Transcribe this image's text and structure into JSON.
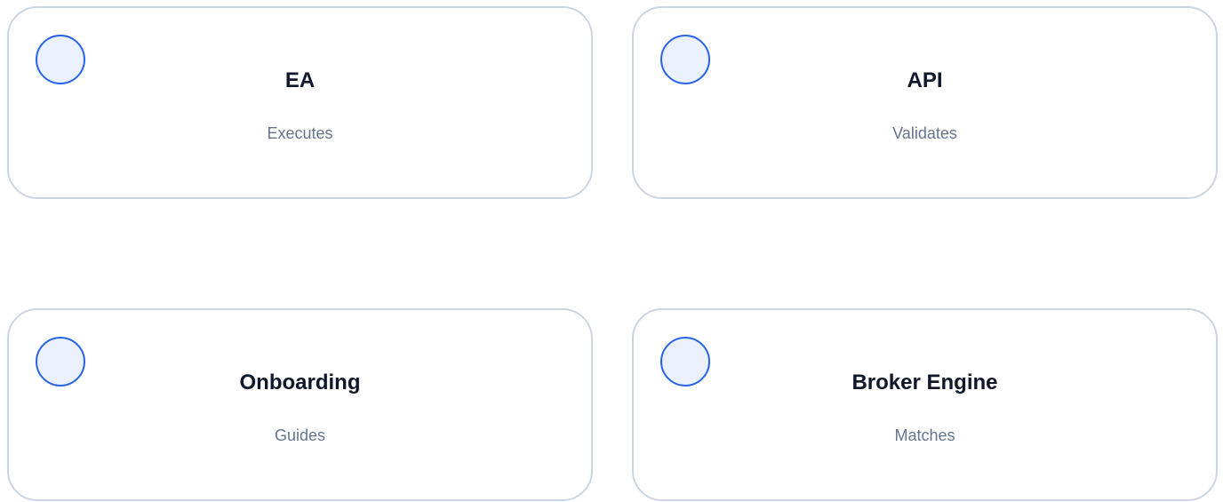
{
  "colors": {
    "card_border": "#cbd5e1",
    "circle_border": "#2563eb",
    "circle_fill": "#eaf0fc",
    "title_text": "#0f172a",
    "subtitle_text": "#64748b"
  },
  "nodes": [
    {
      "icon": "circle-icon",
      "title": "EA",
      "subtitle": "Executes"
    },
    {
      "icon": "circle-icon",
      "title": "API",
      "subtitle": "Validates"
    },
    {
      "icon": "circle-icon",
      "title": "Onboarding",
      "subtitle": "Guides"
    },
    {
      "icon": "circle-icon",
      "title": "Broker Engine",
      "subtitle": "Matches"
    }
  ]
}
